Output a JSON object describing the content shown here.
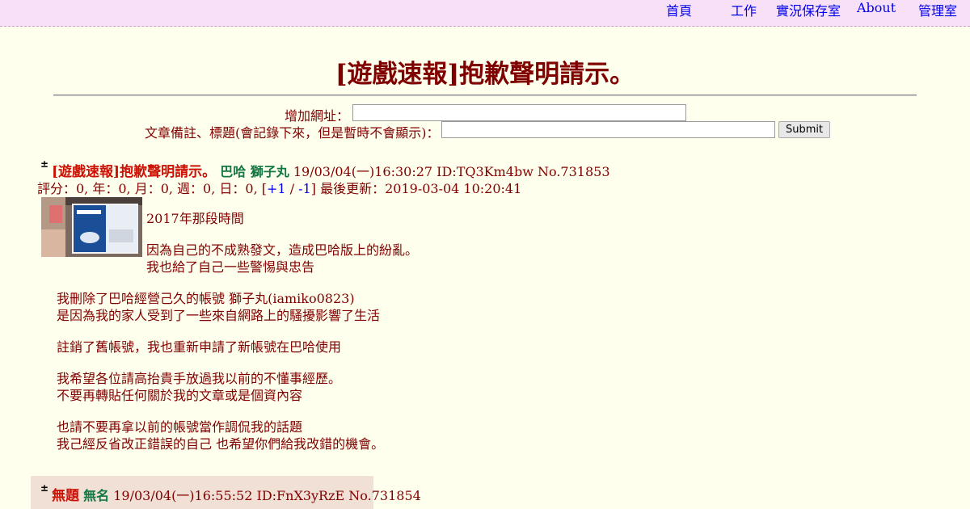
{
  "nav": [
    "首頁",
    "工作",
    "實況保存室",
    "About",
    "管理室"
  ],
  "title": "[遊戲速報]抱歉聲明請示。",
  "form": {
    "url_label": "增加網址：",
    "note_label": "文章備註、標題(會記錄下來，但是暫時不會顯示)：",
    "submit": "Submit"
  },
  "post": {
    "toggle": "±",
    "title": "[遊戲速報]抱歉聲明請示。",
    "name": "巴哈 獅子丸",
    "datetime": "19/03/04(一)16:30:27 ID:TQ3Km4bw No.731853",
    "score_text": "評分：0, 年：0, 月：0, 週：0, 日：0, [",
    "plus": "+1",
    "sep": " / ",
    "minus": "-1",
    "updated": "] 最後更新：2019-03-04 10:20:41",
    "body": [
      "2017年那段時間",
      "因為自己的不成熟發文，造成巴哈版上的紛亂。",
      "我也給了自己一些警惕與忠告",
      "我刪除了巴哈經營己久的帳號 獅子丸(iamiko0823)",
      "是因為我的家人受到了一些來自網路上的騷擾影響了生活",
      "註銷了舊帳號，我也重新申請了新帳號在巴哈使用",
      "我希望各位請高抬貴手放過我以前的不懂事經歷。",
      "不要再轉貼任何關於我的文章或是個資內容",
      "也請不要再拿以前的帳號當作調侃我的話題",
      "我己經反省改正錯誤的自己 也希望你們給我改錯的機會。"
    ]
  },
  "reply": {
    "toggle": "±",
    "title": "無題",
    "name": "無名",
    "datetime": "19/03/04(一)16:55:52 ID:FnX3yRzE No.731854"
  },
  "colors": {
    "background": "#FFFFEE",
    "text": "#800000",
    "post_title": "#CC1105",
    "name": "#117743",
    "link": "#0000EE",
    "nav_bg": "#F8E0F8",
    "reply_bg": "#F0E0D6"
  }
}
